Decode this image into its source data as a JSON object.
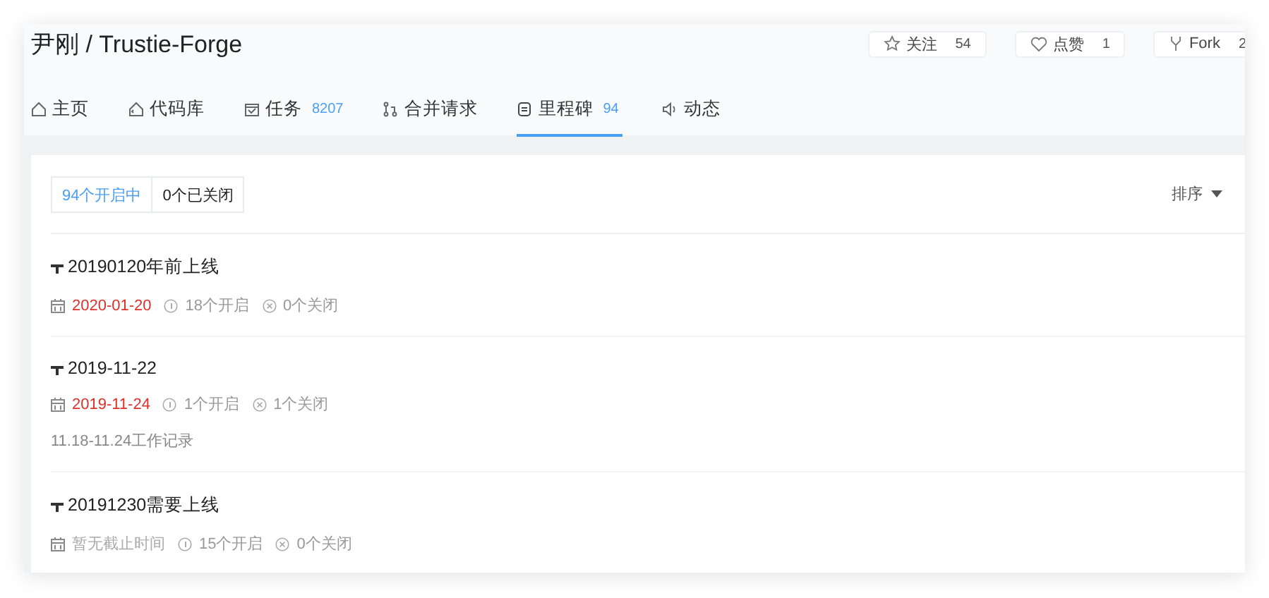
{
  "header": {
    "owner": "尹刚",
    "separator": "/",
    "repo": "Trustie-Forge"
  },
  "actions": [
    {
      "kind": "star",
      "label": "关注",
      "count": "54"
    },
    {
      "kind": "heart",
      "label": "点赞",
      "count": "1"
    },
    {
      "kind": "fork",
      "label": "Fork",
      "count": "2"
    }
  ],
  "tabs": [
    {
      "kind": "home",
      "label": "主页",
      "selected": false
    },
    {
      "kind": "code",
      "label": "代码库",
      "selected": false
    },
    {
      "kind": "issue",
      "label": "任务",
      "count": "8207",
      "selected": false
    },
    {
      "kind": "merge",
      "label": "合并请求",
      "selected": false
    },
    {
      "kind": "milestone",
      "label": "里程碑",
      "count": "94",
      "selected": true
    },
    {
      "kind": "activity",
      "label": "动态",
      "selected": false
    }
  ],
  "filters": [
    {
      "label": "94个开启中",
      "selected": true
    },
    {
      "label": "0个已关闭",
      "selected": false
    }
  ],
  "sort": {
    "label": "排序"
  },
  "milestones": [
    {
      "title": "20190120年前上线",
      "due": "2020-01-20",
      "overdue": true,
      "open": "18个开启",
      "closed": "0个关闭"
    },
    {
      "title": "2019-11-22",
      "due": "2019-11-24",
      "overdue": true,
      "open": "1个开启",
      "closed": "1个关闭",
      "description": "11.18-11.24工作记录"
    },
    {
      "title": "20191230需要上线",
      "due": "暂无截止时间",
      "overdue": false,
      "open": "15个开启",
      "closed": "0个关闭"
    }
  ]
}
